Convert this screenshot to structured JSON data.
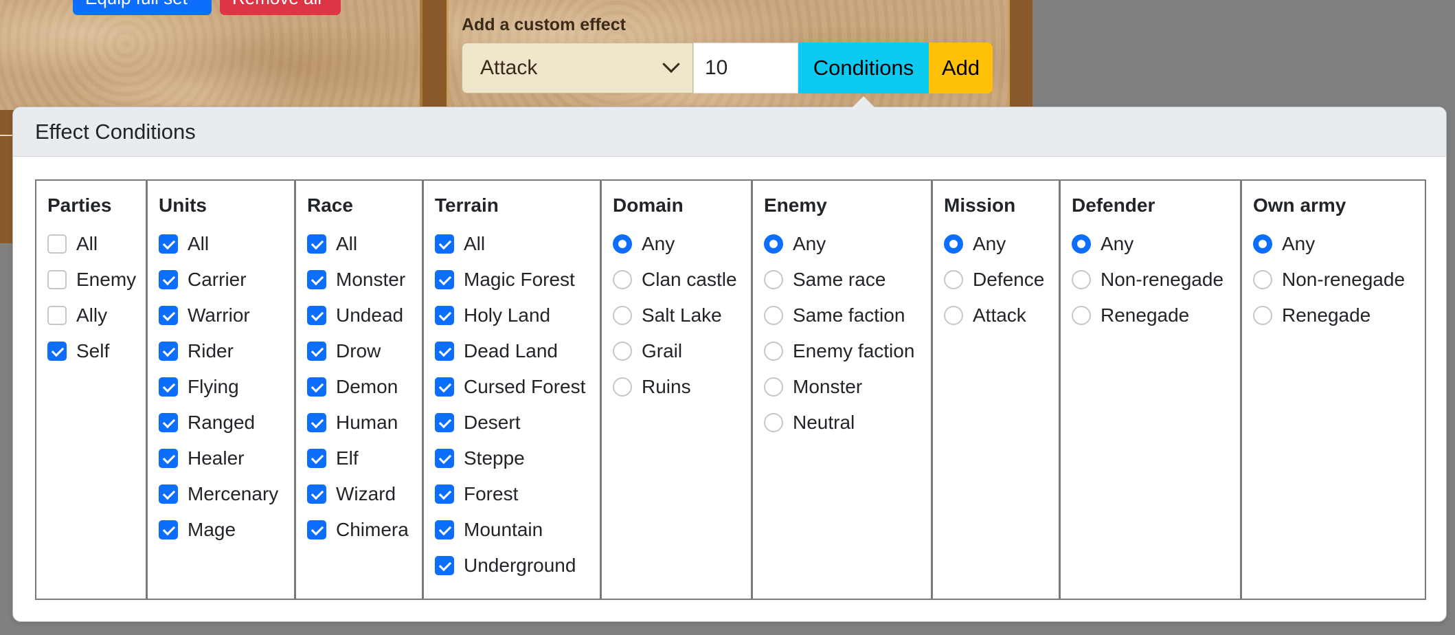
{
  "background": {
    "top_buttons": [
      {
        "label": "Equip full set",
        "color": "#0d6efd"
      },
      {
        "label": "Remove all",
        "color": "#dc3545"
      }
    ],
    "custom_effect": {
      "label": "Add a custom effect",
      "effect_select_value": "Attack",
      "amount_value": "10",
      "conditions_label": "Conditions",
      "add_label": "Add"
    }
  },
  "popover": {
    "title": "Effect Conditions",
    "columns": [
      {
        "title": "Parties",
        "type": "checkbox",
        "options": [
          {
            "label": "All",
            "checked": false
          },
          {
            "label": "Enemy",
            "checked": false
          },
          {
            "label": "Ally",
            "checked": false
          },
          {
            "label": "Self",
            "checked": true
          }
        ]
      },
      {
        "title": "Units",
        "type": "checkbox",
        "options": [
          {
            "label": "All",
            "checked": true
          },
          {
            "label": "Carrier",
            "checked": true
          },
          {
            "label": "Warrior",
            "checked": true
          },
          {
            "label": "Rider",
            "checked": true
          },
          {
            "label": "Flying",
            "checked": true
          },
          {
            "label": "Ranged",
            "checked": true
          },
          {
            "label": "Healer",
            "checked": true
          },
          {
            "label": "Mercenary",
            "checked": true
          },
          {
            "label": "Mage",
            "checked": true
          }
        ]
      },
      {
        "title": "Race",
        "type": "checkbox",
        "options": [
          {
            "label": "All",
            "checked": true
          },
          {
            "label": "Monster",
            "checked": true
          },
          {
            "label": "Undead",
            "checked": true
          },
          {
            "label": "Drow",
            "checked": true
          },
          {
            "label": "Demon",
            "checked": true
          },
          {
            "label": "Human",
            "checked": true
          },
          {
            "label": "Elf",
            "checked": true
          },
          {
            "label": "Wizard",
            "checked": true
          },
          {
            "label": "Chimera",
            "checked": true
          }
        ]
      },
      {
        "title": "Terrain",
        "type": "checkbox",
        "options": [
          {
            "label": "All",
            "checked": true
          },
          {
            "label": "Magic Forest",
            "checked": true
          },
          {
            "label": "Holy Land",
            "checked": true
          },
          {
            "label": "Dead Land",
            "checked": true
          },
          {
            "label": "Cursed Forest",
            "checked": true
          },
          {
            "label": "Desert",
            "checked": true
          },
          {
            "label": "Steppe",
            "checked": true
          },
          {
            "label": "Forest",
            "checked": true
          },
          {
            "label": "Mountain",
            "checked": true
          },
          {
            "label": "Underground",
            "checked": true
          }
        ]
      },
      {
        "title": "Domain",
        "type": "radio",
        "options": [
          {
            "label": "Any",
            "checked": true
          },
          {
            "label": "Clan castle",
            "checked": false
          },
          {
            "label": "Salt Lake",
            "checked": false
          },
          {
            "label": "Grail",
            "checked": false
          },
          {
            "label": "Ruins",
            "checked": false
          }
        ]
      },
      {
        "title": "Enemy",
        "type": "radio",
        "options": [
          {
            "label": "Any",
            "checked": true
          },
          {
            "label": "Same race",
            "checked": false
          },
          {
            "label": "Same faction",
            "checked": false
          },
          {
            "label": "Enemy faction",
            "checked": false
          },
          {
            "label": "Monster",
            "checked": false
          },
          {
            "label": "Neutral",
            "checked": false
          }
        ]
      },
      {
        "title": "Mission",
        "type": "radio",
        "options": [
          {
            "label": "Any",
            "checked": true
          },
          {
            "label": "Defence",
            "checked": false
          },
          {
            "label": "Attack",
            "checked": false
          }
        ]
      },
      {
        "title": "Defender",
        "type": "radio",
        "options": [
          {
            "label": "Any",
            "checked": true
          },
          {
            "label": "Non-renegade",
            "checked": false
          },
          {
            "label": "Renegade",
            "checked": false
          }
        ]
      },
      {
        "title": "Own army",
        "type": "radio",
        "options": [
          {
            "label": "Any",
            "checked": true
          },
          {
            "label": "Non-renegade",
            "checked": false
          },
          {
            "label": "Renegade",
            "checked": false
          }
        ]
      }
    ]
  },
  "colors": {
    "accent": "#0d6efd",
    "info": "#0dcaf0",
    "warning": "#ffc107",
    "danger": "#dc3545"
  }
}
